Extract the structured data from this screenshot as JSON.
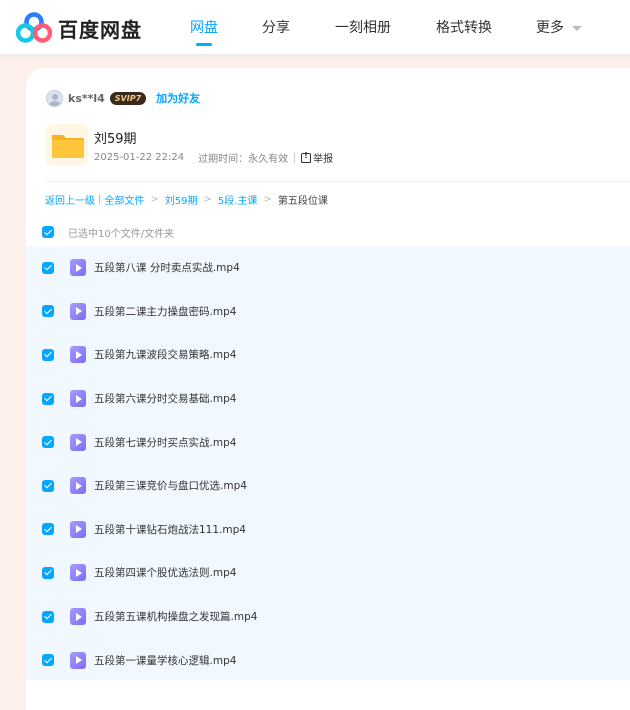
{
  "brand": {
    "name": "百度网盘"
  },
  "nav": {
    "items": [
      {
        "label": "网盘",
        "active": true
      },
      {
        "label": "分享",
        "active": false
      },
      {
        "label": "一刻相册",
        "active": false
      },
      {
        "label": "格式转换",
        "active": false
      },
      {
        "label": "更多",
        "active": false
      }
    ]
  },
  "share": {
    "user_name": "ks**l4",
    "badge": "SVIP7",
    "add_friend_label": "加为好友",
    "folder_title": "刘59期",
    "share_time": "2025-01-22 22:24",
    "expire_label": "过期时间：永久有效",
    "report_label": "举报"
  },
  "breadcrumb": {
    "back": "返回上一级",
    "all_files": "全部文件",
    "level1": "刘59期",
    "level2": "5段.主课",
    "current": "第五段位课"
  },
  "selection": {
    "label": "已选中10个文件/文件夹"
  },
  "files": [
    {
      "name": "五段第八课 分时卖点实战.mp4",
      "checked": true
    },
    {
      "name": "五段第二课主力操盘密码.mp4",
      "checked": true
    },
    {
      "name": "五段第九课波段交易策略.mp4",
      "checked": true
    },
    {
      "name": "五段第六课分时交易基础.mp4",
      "checked": true
    },
    {
      "name": "五段第七课分时买点实战.mp4",
      "checked": true
    },
    {
      "name": "五段第三课竞价与盘口优选.mp4",
      "checked": true
    },
    {
      "name": "五段第十课钻石炮战法111.mp4",
      "checked": true
    },
    {
      "name": "五段第四课个股优选法则.mp4",
      "checked": true
    },
    {
      "name": "五段第五课机构操盘之发现篇.mp4",
      "checked": true
    },
    {
      "name": "五段第一课量学核心逻辑.mp4",
      "checked": true
    }
  ],
  "colors": {
    "accent": "#06a7ff",
    "page_bg": "#fdf0ea",
    "list_bg": "#f1f8ff",
    "folder": "#ffc53d",
    "video": "#8c7cf8"
  },
  "icons": {
    "logo": "baidu-netdisk-logo-icon",
    "folder": "folder-icon",
    "video": "video-file-icon",
    "checkbox": "checkbox-checked-icon",
    "report": "report-icon",
    "avatar": "user-avatar-icon"
  }
}
